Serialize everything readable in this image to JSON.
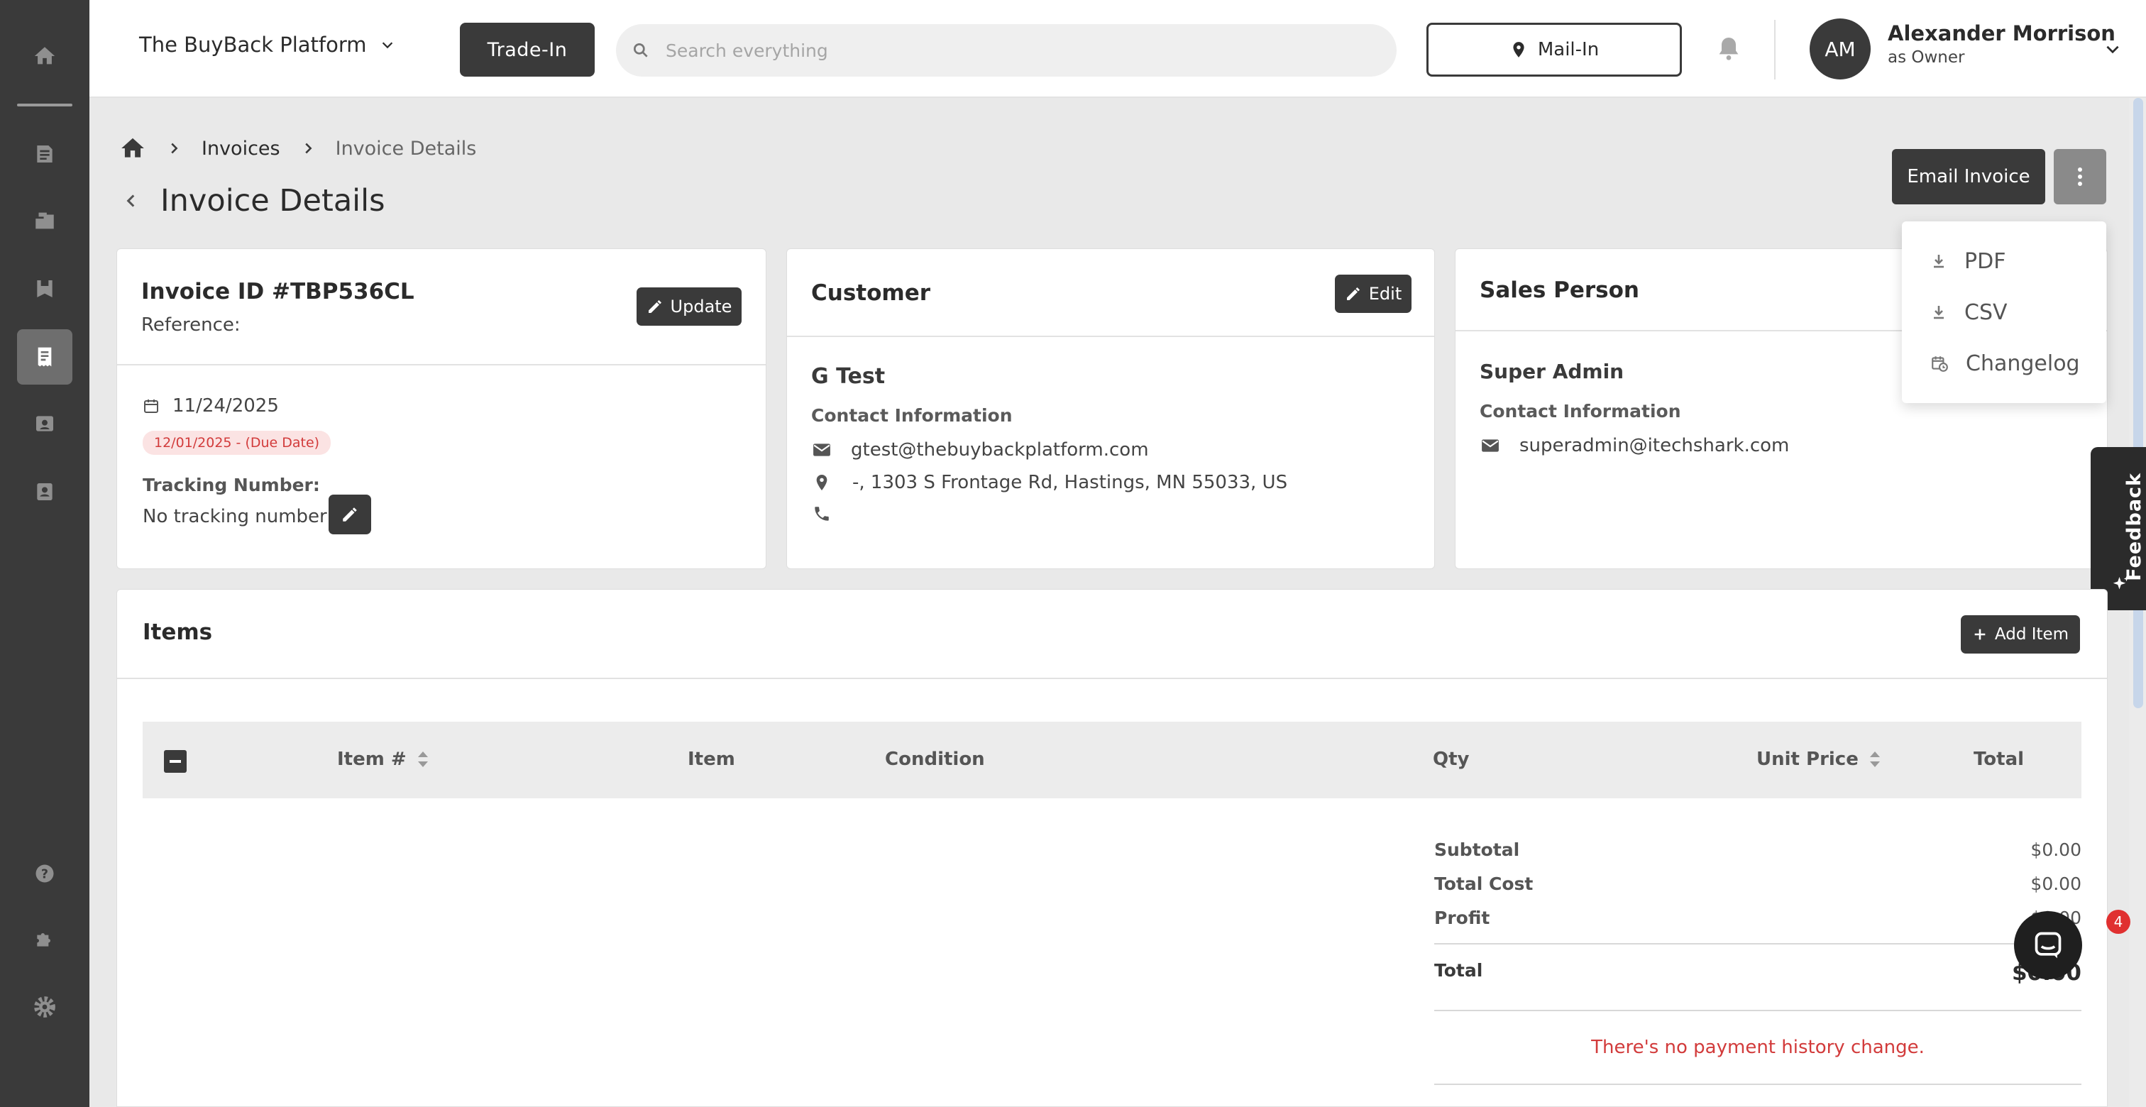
{
  "header": {
    "platform_name": "The BuyBack Platform",
    "tradein_label": "Trade-In",
    "search_placeholder": "Search everything",
    "mailin_label": "Mail-In",
    "user_initials": "AM",
    "user_name": "Alexander Morrison",
    "user_role": "as Owner"
  },
  "sidebar": {
    "items": [
      {
        "icon": "home-icon"
      },
      {
        "icon": "document-icon"
      },
      {
        "icon": "boxes-icon"
      },
      {
        "icon": "save-icon"
      },
      {
        "icon": "invoice-icon",
        "active": true
      },
      {
        "icon": "archive-icon"
      },
      {
        "icon": "contacts-icon"
      }
    ],
    "bottom_items": [
      {
        "icon": "help-icon"
      },
      {
        "icon": "puzzle-icon"
      },
      {
        "icon": "gear-icon"
      }
    ]
  },
  "breadcrumb": {
    "home_icon": "home-icon",
    "invoices": "Invoices",
    "current": "Invoice Details"
  },
  "page": {
    "title": "Invoice Details",
    "email_invoice_label": "Email Invoice"
  },
  "more_menu": {
    "items": [
      {
        "label": "PDF",
        "icon": "download-icon"
      },
      {
        "label": "CSV",
        "icon": "download-icon"
      },
      {
        "label": "Changelog",
        "icon": "calendar-clock-icon"
      }
    ]
  },
  "invoice_card": {
    "title": "Invoice ID #TBP536CL",
    "reference_label": "Reference:",
    "update_label": "Update",
    "date": "11/24/2025",
    "due_badge": "12/01/2025 - (Due Date)",
    "tracking_label": "Tracking Number:",
    "tracking_value": "No tracking number"
  },
  "customer_card": {
    "title": "Customer",
    "edit_label": "Edit",
    "name": "G Test",
    "contact_label": "Contact Information",
    "email": "gtest@thebuybackplatform.com",
    "address": "-, 1303 S Frontage Rd, Hastings, MN 55033, US",
    "phone": ""
  },
  "sales_card": {
    "title": "Sales Person",
    "name": "Super Admin",
    "contact_label": "Contact Information",
    "email": "superadmin@itechshark.com"
  },
  "feedback_label": "Feedback",
  "items_panel": {
    "title": "Items",
    "add_label": "Add Item",
    "columns": [
      "Item #",
      "Item",
      "Condition",
      "Qty",
      "Unit Price",
      "Total"
    ],
    "summary": {
      "subtotal_label": "Subtotal",
      "subtotal": "$0.00",
      "total_cost_label": "Total Cost",
      "total_cost": "$0.00",
      "profit_label": "Profit",
      "profit": "$0.00",
      "total_label": "Total",
      "total": "$0.00"
    },
    "payment_message": "There's no payment history change."
  },
  "chat_badge": "4",
  "colors": {
    "dark": "#3a3a3a",
    "error": "#d23b3b",
    "badge_bg": "#fbe3e3"
  }
}
